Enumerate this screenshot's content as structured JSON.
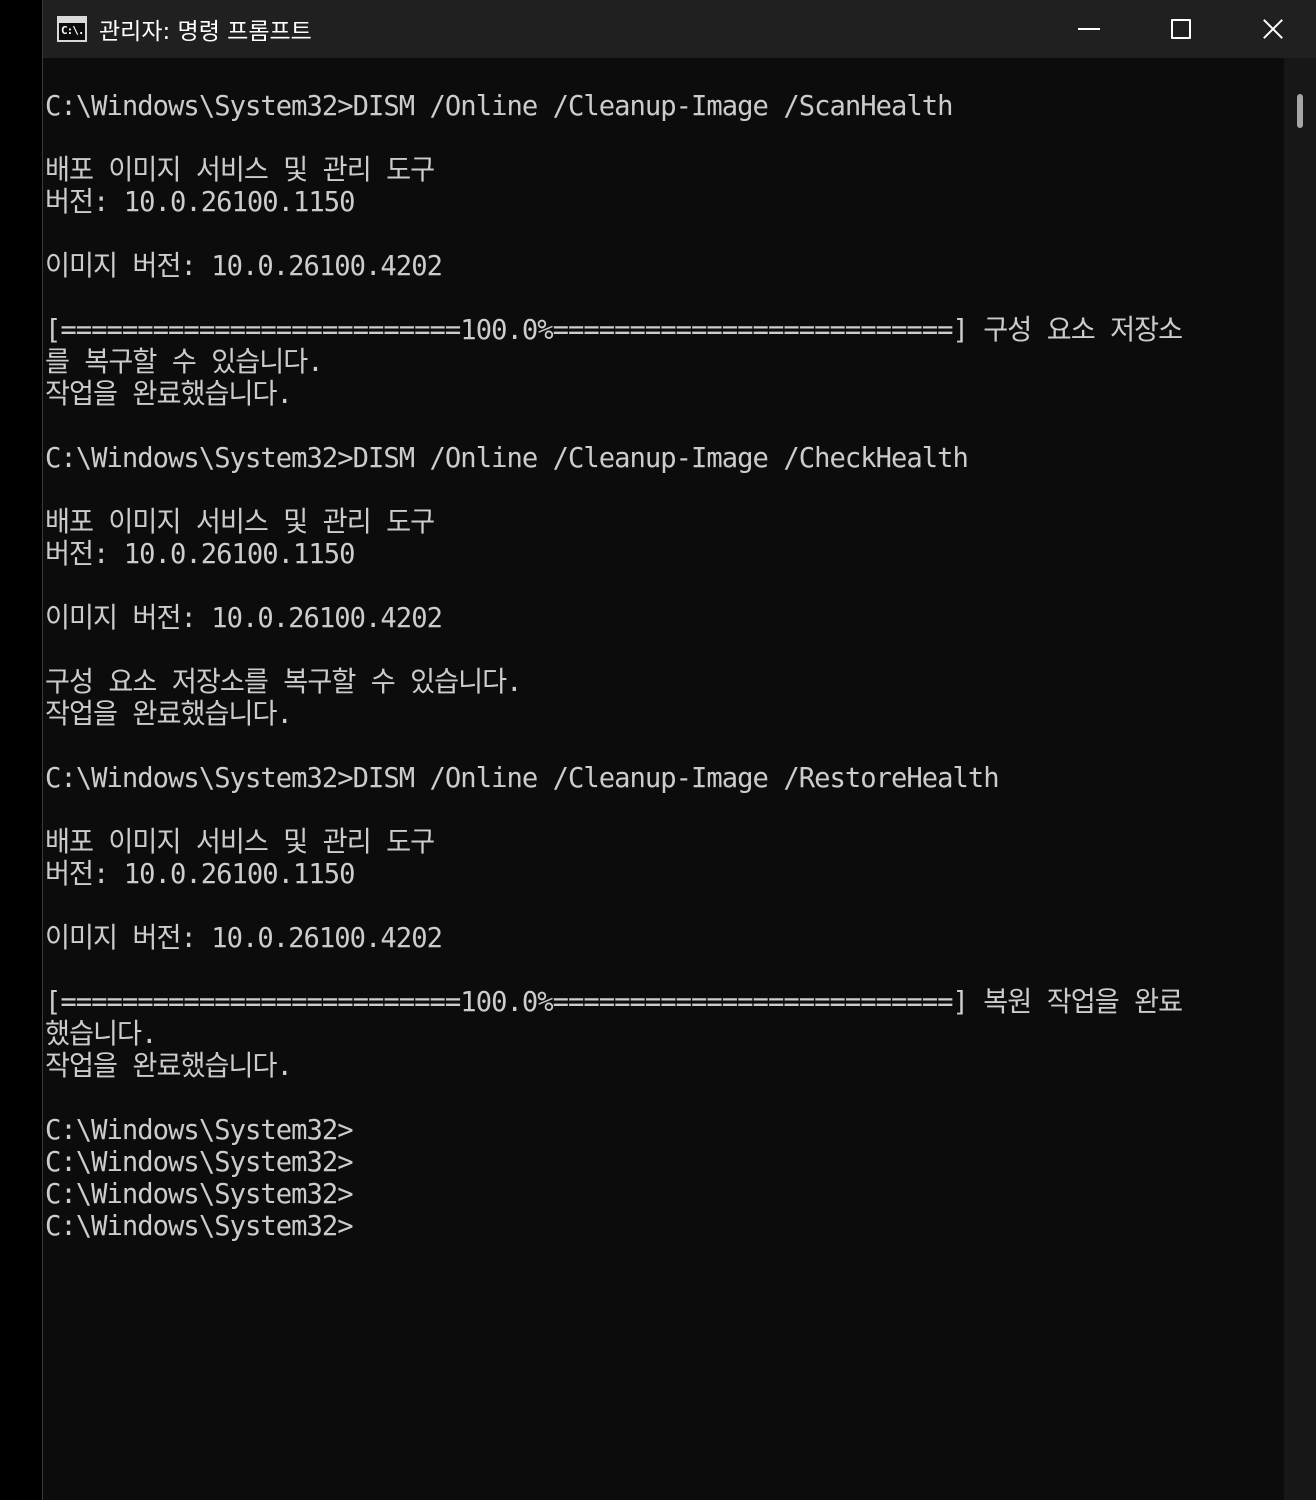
{
  "window": {
    "title": "관리자: 명령 프롬프트",
    "icon_label": "C:\\.",
    "icon": "cmd-icon",
    "controls": [
      "minimize-icon",
      "maximize-icon",
      "close-icon"
    ]
  },
  "console": {
    "lines": [
      "C:\\Windows\\System32>DISM /Online /Cleanup-Image /ScanHealth",
      "",
      "배포 이미지 서비스 및 관리 도구",
      "버전: 10.0.26100.1150",
      "",
      "이미지 버전: 10.0.26100.4202",
      "",
      "[==========================100.0%==========================] 구성 요소 저장소",
      "를 복구할 수 있습니다.",
      "작업을 완료했습니다.",
      "",
      "C:\\Windows\\System32>DISM /Online /Cleanup-Image /CheckHealth",
      "",
      "배포 이미지 서비스 및 관리 도구",
      "버전: 10.0.26100.1150",
      "",
      "이미지 버전: 10.0.26100.4202",
      "",
      "구성 요소 저장소를 복구할 수 있습니다.",
      "작업을 완료했습니다.",
      "",
      "C:\\Windows\\System32>DISM /Online /Cleanup-Image /RestoreHealth",
      "",
      "배포 이미지 서비스 및 관리 도구",
      "버전: 10.0.26100.1150",
      "",
      "이미지 버전: 10.0.26100.4202",
      "",
      "[==========================100.0%==========================] 복원 작업을 완료",
      "했습니다.",
      "작업을 완료했습니다.",
      "",
      "C:\\Windows\\System32>",
      "C:\\Windows\\System32>",
      "C:\\Windows\\System32>",
      "C:\\Windows\\System32>"
    ]
  },
  "colors": {
    "console_bg": "#0c0c0c",
    "console_fg": "#cccccc",
    "titlebar_bg": "#202020"
  }
}
